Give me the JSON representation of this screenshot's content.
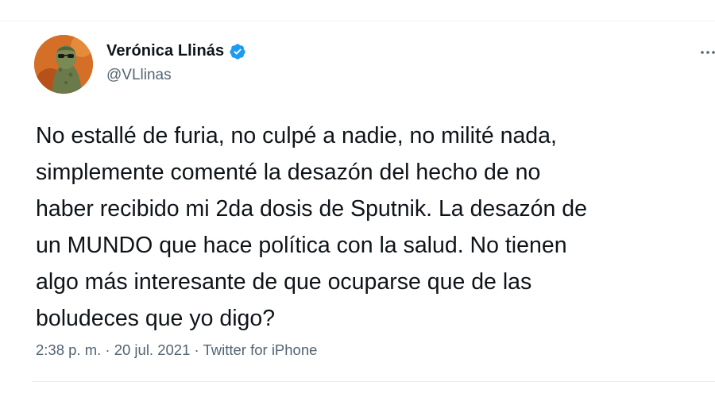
{
  "tweet": {
    "author": {
      "display_name": "Verónica Llinás",
      "handle": "@VLlinas",
      "verified": true,
      "avatar_icon": "profile-photo",
      "verified_icon": "verified-badge-icon"
    },
    "text": "No estallé de furia, no culpé a nadie, no milité nada,\nsimplemente comenté la desazón del hecho de no\nhaber recibido mi 2da dosis de Sputnik. La desazón de\nun MUNDO que hace política con la salud. No tienen\nalgo más interesante de que ocuparse que de las\nboludeces que yo digo?",
    "timestamp": "2:38 p. m. · 20 jul. 2021 · Twitter for iPhone",
    "more_icon": "more-options-icon"
  },
  "colors": {
    "verified_blue": "#1d9bf0",
    "text_primary": "#0f1419",
    "text_secondary": "#536471"
  }
}
